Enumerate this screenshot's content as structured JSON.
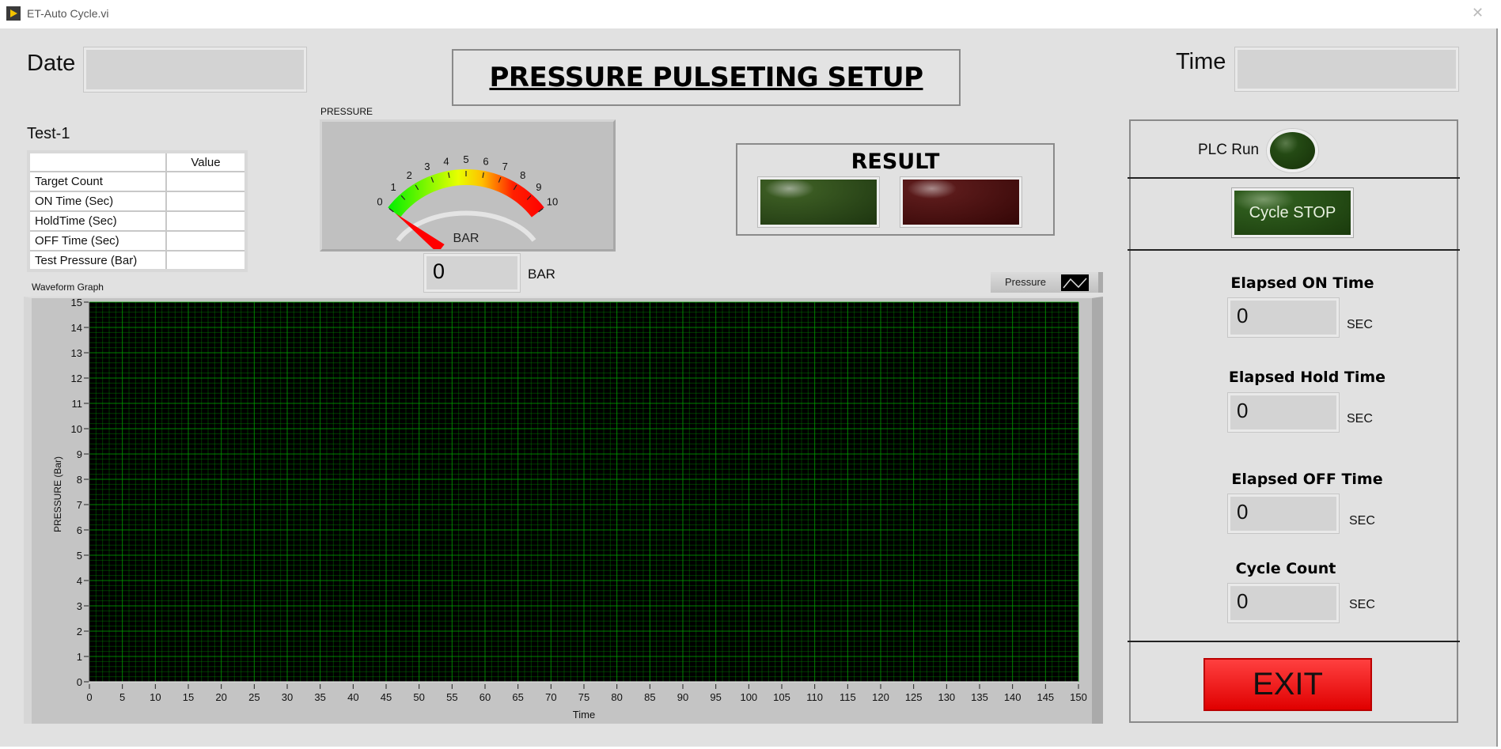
{
  "window": {
    "title": "ET-Auto Cycle.vi"
  },
  "header": {
    "date_label": "Date",
    "date_value": "",
    "title": "PRESSURE PULSETING SETUP",
    "time_label": "Time",
    "time_value": ""
  },
  "table": {
    "title": "Test-1",
    "column_header": "Value",
    "rows": [
      {
        "label": "Target Count",
        "value": ""
      },
      {
        "label": "ON Time (Sec)",
        "value": ""
      },
      {
        "label": "HoldTime (Sec)",
        "value": ""
      },
      {
        "label": "OFF Time (Sec)",
        "value": ""
      },
      {
        "label": "Test Pressure (Bar)",
        "value": ""
      }
    ]
  },
  "gauge": {
    "label": "PRESSURE",
    "unit": "BAR",
    "min": 0,
    "max": 10,
    "value": 0,
    "ticks": [
      "0",
      "1",
      "2",
      "3",
      "4",
      "5",
      "6",
      "7",
      "8",
      "9",
      "10"
    ],
    "readout": "0",
    "readout_unit": "BAR"
  },
  "result": {
    "label": "RESULT",
    "pass_color": "#2e4a1a",
    "fail_color": "#4a0a0a"
  },
  "status": {
    "plc_run_label": "PLC Run",
    "plc_run_on": false,
    "cycle_stop_label": "Cycle STOP"
  },
  "metrics": [
    {
      "label": "Elapsed ON Time",
      "value": "0",
      "unit": "SEC"
    },
    {
      "label": "Elapsed Hold Time",
      "value": "0",
      "unit": "SEC"
    },
    {
      "label": "Elapsed OFF Time",
      "value": "0",
      "unit": "SEC"
    },
    {
      "label": "Cycle Count",
      "value": "0",
      "unit": "SEC"
    }
  ],
  "exit_label": "EXIT",
  "chart_data": {
    "type": "line",
    "title": "Waveform Graph",
    "xlabel": "Time",
    "ylabel": "PRESSURE (Bar)",
    "xlim": [
      0,
      150
    ],
    "ylim": [
      0,
      15
    ],
    "xticks": [
      "0",
      "5",
      "10",
      "15",
      "20",
      "25",
      "30",
      "35",
      "40",
      "45",
      "50",
      "55",
      "60",
      "65",
      "70",
      "75",
      "80",
      "85",
      "90",
      "95",
      "100",
      "105",
      "110",
      "115",
      "120",
      "125",
      "130",
      "135",
      "140",
      "145",
      "150"
    ],
    "yticks": [
      "0",
      "1",
      "2",
      "3",
      "4",
      "5",
      "6",
      "7",
      "8",
      "9",
      "10",
      "11",
      "12",
      "13",
      "14",
      "15"
    ],
    "grid": true,
    "legend": "top-right",
    "series": [
      {
        "name": "Pressure",
        "x": [],
        "y": []
      }
    ],
    "background": "#000000",
    "grid_color": "#00a000"
  }
}
